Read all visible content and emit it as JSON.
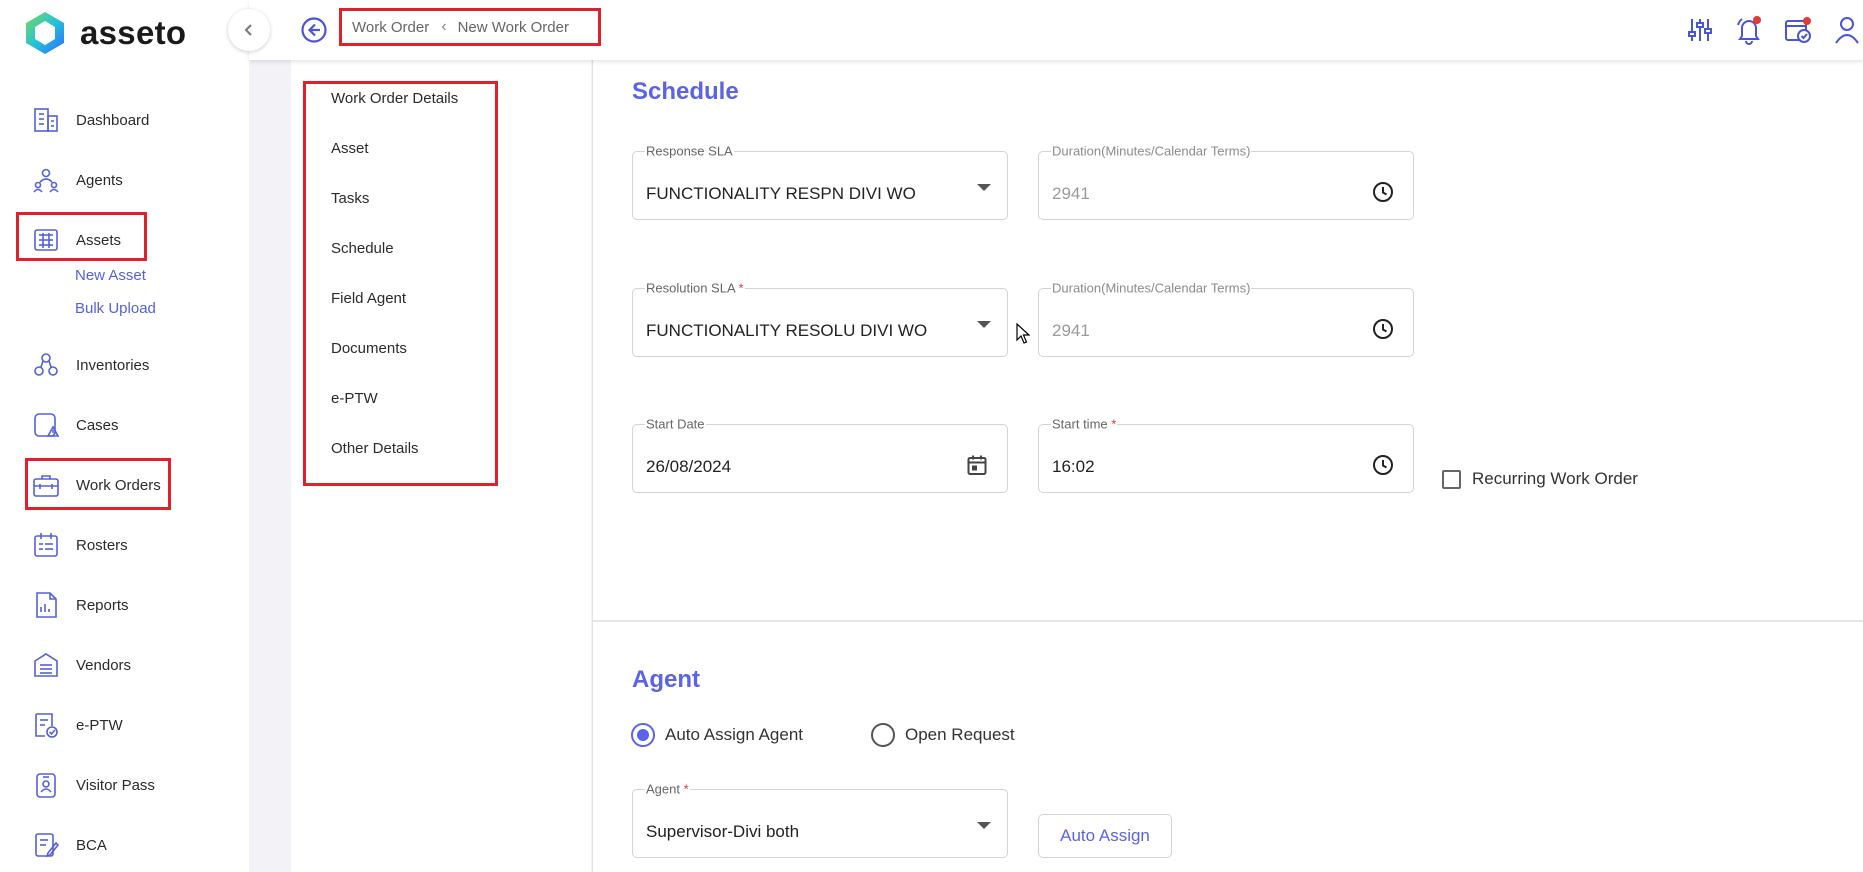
{
  "brand": {
    "name": "asseto"
  },
  "sidebar": {
    "items": [
      {
        "label": "Dashboard",
        "icon": "dashboard-icon"
      },
      {
        "label": "Agents",
        "icon": "agents-icon"
      },
      {
        "label": "Assets",
        "icon": "assets-icon"
      },
      {
        "label": "Inventories",
        "icon": "inventories-icon"
      },
      {
        "label": "Cases",
        "icon": "cases-icon"
      },
      {
        "label": "Work Orders",
        "icon": "work-orders-icon"
      },
      {
        "label": "Rosters",
        "icon": "rosters-icon"
      },
      {
        "label": "Reports",
        "icon": "reports-icon"
      },
      {
        "label": "Vendors",
        "icon": "vendors-icon"
      },
      {
        "label": "e-PTW",
        "icon": "eptw-icon"
      },
      {
        "label": "Visitor Pass",
        "icon": "visitor-pass-icon"
      },
      {
        "label": "BCA",
        "icon": "bca-icon"
      }
    ],
    "asset_subitems": [
      "New Asset",
      "Bulk Upload"
    ]
  },
  "header": {
    "breadcrumb": [
      "Work Order",
      "New Work Order"
    ],
    "icons": [
      "filter-settings-icon",
      "notification-bell-icon",
      "task-calendar-icon",
      "user-profile-icon"
    ]
  },
  "section_nav": [
    "Work Order Details",
    "Asset",
    "Tasks",
    "Schedule",
    "Field Agent",
    "Documents",
    "e-PTW",
    "Other Details"
  ],
  "schedule": {
    "title": "Schedule",
    "response_sla": {
      "label": "Response SLA",
      "value": "FUNCTIONALITY RESPN DIVI WO"
    },
    "response_duration": {
      "label": "Duration(Minutes/Calendar Terms)",
      "value": "2941"
    },
    "resolution_sla": {
      "label": "Resolution SLA",
      "required": "*",
      "value": "FUNCTIONALITY RESOLU DIVI WO"
    },
    "resolution_duration": {
      "label": "Duration(Minutes/Calendar Terms)",
      "value": "2941"
    },
    "start_date": {
      "label": "Start Date",
      "value": "26/08/2024"
    },
    "start_time": {
      "label": "Start time",
      "required": "*",
      "value": "16:02"
    },
    "recurring": {
      "label": "Recurring Work Order",
      "checked": false
    }
  },
  "agent": {
    "title": "Agent",
    "radio_auto": {
      "label": "Auto Assign Agent",
      "checked": true
    },
    "radio_open": {
      "label": "Open Request",
      "checked": false
    },
    "agent_field": {
      "label": "Agent",
      "required": "*",
      "value": "Supervisor-Divi both"
    },
    "auto_assign_button": "Auto Assign"
  },
  "colors": {
    "accent": "#5b63e6",
    "highlight": "#e0202a",
    "background": "#f3f3f7"
  }
}
